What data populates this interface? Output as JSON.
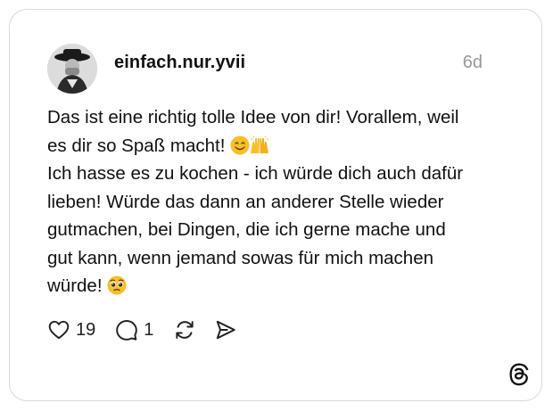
{
  "post": {
    "username": "einfach.nur.yvii",
    "timestamp": "6d",
    "text_lines": [
      "Das ist eine richtig tolle Idee von dir! Vorallem, weil",
      "es dir so Spaß macht!",
      "Ich hasse es zu kochen - ich würde dich auch dafür",
      "lieben! Würde das dann an anderer Stelle wieder",
      "gutmachen, bei Dingen, die ich gerne mache und",
      "gut kann, wenn jemand sowas für mich machen",
      "würde!"
    ],
    "emojis": [
      "smiling-face-emoji",
      "raising-hands-emoji",
      "pleading-face-emoji"
    ]
  },
  "actions": {
    "likes": "19",
    "replies": "1",
    "icons": [
      "heart-icon",
      "comment-icon",
      "repost-icon",
      "share-icon"
    ]
  },
  "brand": {
    "logo": "threads-logo-icon"
  },
  "colors": {
    "text": "#111111",
    "muted": "#9a9a9a",
    "border": "#d9d9d9",
    "emoji": "#f7c02a"
  }
}
